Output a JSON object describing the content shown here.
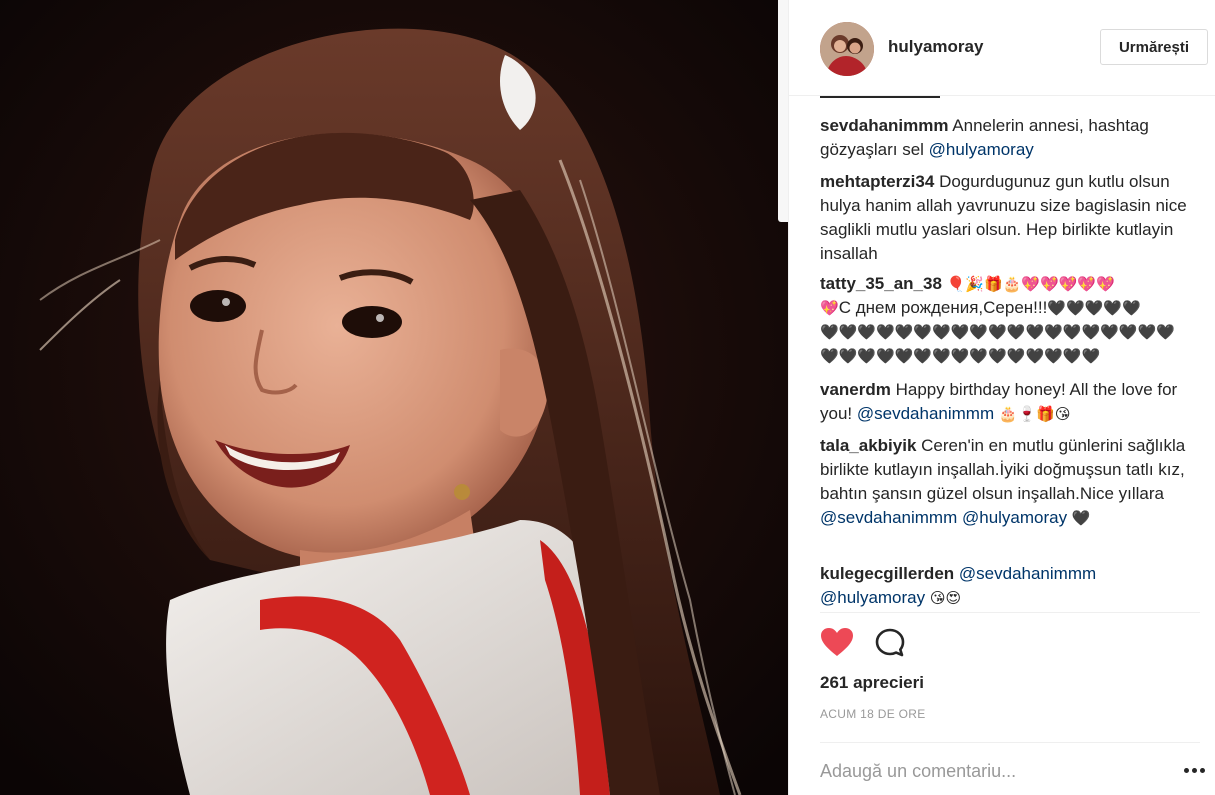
{
  "post": {
    "username": "hulyamoray",
    "follow_label": "Urmărești",
    "avatar_icon": "avatar-photo",
    "comments": [
      {
        "user": "sevdahanimmm",
        "text": "Annelerin annesi, hashtag gözyaşları sel",
        "mention": "@hulyamoray"
      },
      {
        "user": "mehtapterzi34",
        "text": "Dogurdugunuz gun kutlu olsun hulya hanim allah yavrunuzu size bagislasin nice saglikli mutlu yaslari olsun. Hep birlikte kutlayin insallah"
      },
      {
        "user": "tatty_35_an_38",
        "emojis_1": "🎈🎉🎁🎂💖💖💖💖💖",
        "emojis_2": "💖",
        "text": "С днем рождения,Серен!!!",
        "hearts_1": "🖤🖤🖤🖤🖤",
        "hearts_2": "🖤🖤🖤🖤🖤🖤🖤🖤🖤🖤🖤🖤🖤🖤🖤🖤🖤🖤🖤",
        "hearts_3": "🖤🖤🖤🖤🖤🖤🖤🖤🖤🖤🖤🖤🖤🖤🖤"
      },
      {
        "user": "vanerdm",
        "text": "Happy birthday honey! All the love for you!",
        "mention": "@sevdahanimmm",
        "emojis": "🎂🍷🎁😘"
      },
      {
        "user": "tala_akbiyik",
        "text": "Ceren'in en mutlu günlerini sağlıkla birlikte kutlayın inşallah.İyiki doğmuşsun tatlı kız, bahtın şansın güzel olsun inşallah.Nice yıllara",
        "mention_1": "@sevdahanimmm",
        "mention_2": "@hulyamoray",
        "emojis": "🖤"
      },
      {
        "user": "kulegecgillerden",
        "mention_1": "@sevdahanimmm",
        "mention_2": "@hulyamoray",
        "emojis": "😘😍"
      }
    ],
    "likes": "261 aprecieri",
    "timestamp": "ACUM 18 DE ORE",
    "comment_placeholder": "Adaugă un comentariu...",
    "like_icon": "heart-icon",
    "comment_icon": "speech-bubble-icon",
    "more_icon": "more-options-icon",
    "colors": {
      "like": "#ed4956",
      "mention": "#003569",
      "muted": "#999999",
      "border": "#efefef"
    }
  }
}
